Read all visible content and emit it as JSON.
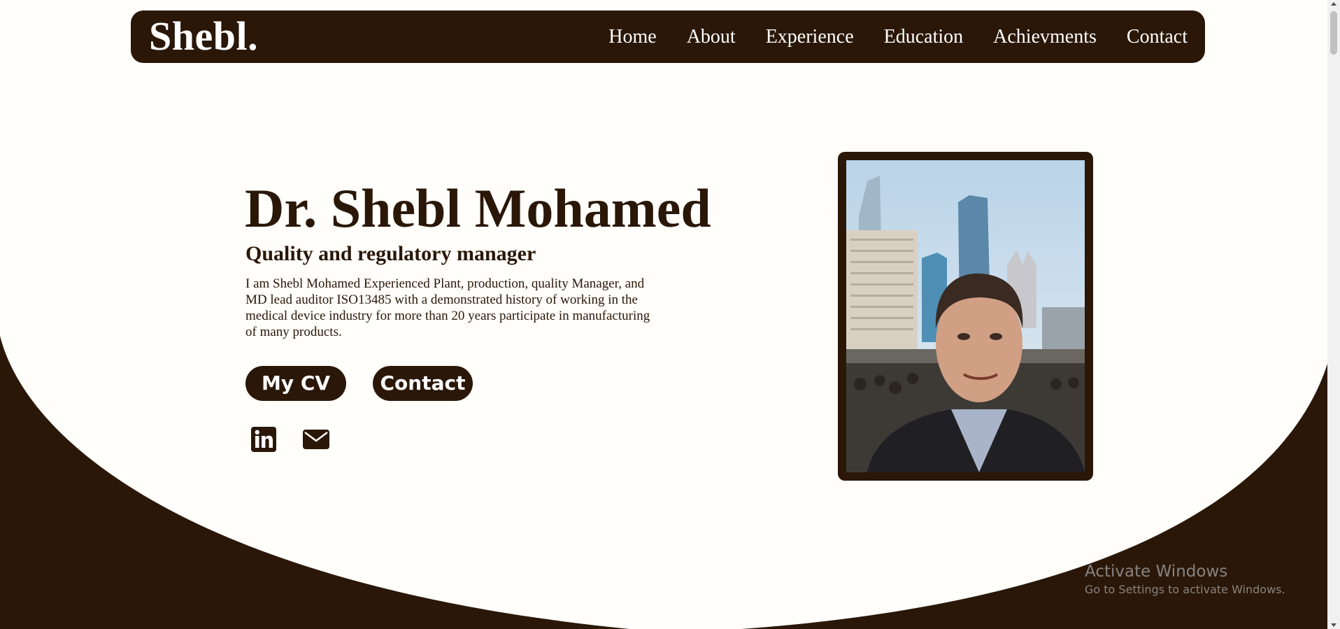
{
  "colors": {
    "brand_dark": "#2a1708",
    "background": "#fffefa",
    "nav_text": "#ffffff"
  },
  "navbar": {
    "logo": "Shebl.",
    "links": [
      {
        "label": "Home"
      },
      {
        "label": "About"
      },
      {
        "label": "Experience"
      },
      {
        "label": "Education"
      },
      {
        "label": "Achievments"
      },
      {
        "label": "Contact"
      }
    ]
  },
  "hero": {
    "title": "Dr. Shebl Mohamed",
    "subtitle": "Quality and regulatory manager",
    "description": "I am Shebl Mohamed Experienced Plant, production, quality Manager, and MD lead auditor ISO13485 with a demonstrated history of working in the medical device industry for more than 20 years participate in manufacturing of many products.",
    "buttons": {
      "cv": "My CV",
      "contact": "Contact"
    },
    "social": [
      {
        "icon": "linkedin-icon"
      },
      {
        "icon": "mail-icon"
      }
    ]
  },
  "watermark": {
    "title": "Activate Windows",
    "subtitle": "Go to Settings to activate Windows."
  }
}
